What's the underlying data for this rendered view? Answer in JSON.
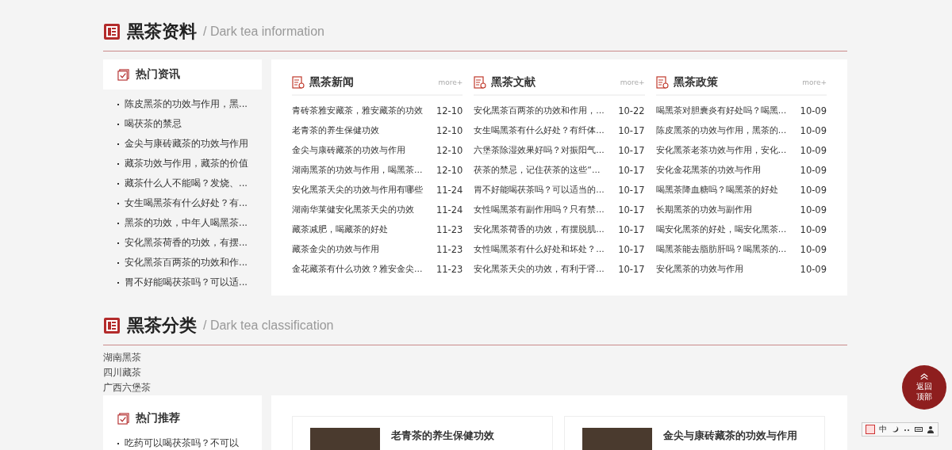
{
  "info_section": {
    "title": "黑茶资料",
    "subtitle": "/ Dark tea information",
    "hot_news": {
      "title": "热门资讯",
      "items": [
        "陈皮黑茶的功效与作用，黑...",
        "喝茯茶的禁忌",
        "金尖与康砖藏茶的功效与作用",
        "藏茶功效与作用，藏茶的价值",
        "藏茶什么人不能喝？发烧、...",
        "女生喝黑茶有什么好处？有...",
        "黑茶的功效，中年人喝黑茶...",
        "安化黑茶荷香的功效，有摆...",
        "安化黑茶百两茶的功效和作...",
        "胃不好能喝茯茶吗？可以适..."
      ]
    },
    "columns": [
      {
        "title": "黑茶新闻",
        "more": "more+",
        "items": [
          {
            "title": "青砖茶雅安藏茶，雅安藏茶的功效",
            "date": "12-10"
          },
          {
            "title": "老青茶的养生保健功效",
            "date": "12-10"
          },
          {
            "title": "金尖与康砖藏茶的功效与作用",
            "date": "12-10"
          },
          {
            "title": "湖南黑茶的功效与作用，喝黑茶...",
            "date": "12-10"
          },
          {
            "title": "安化黑茶天尖的功效与作用有哪些",
            "date": "11-24"
          },
          {
            "title": "湖南华莱健安化黑茶天尖的功效",
            "date": "11-24"
          },
          {
            "title": "藏茶减肥，喝藏茶的好处",
            "date": "11-23"
          },
          {
            "title": "藏茶金尖的功效与作用",
            "date": "11-23"
          },
          {
            "title": "金花藏茶有什么功效？雅安金尖...",
            "date": "11-23"
          }
        ]
      },
      {
        "title": "黑茶文献",
        "more": "more+",
        "items": [
          {
            "title": "安化黑茶百两茶的功效和作用，...",
            "date": "10-22"
          },
          {
            "title": "女生喝黑茶有什么好处？有纤体...",
            "date": "10-17"
          },
          {
            "title": "六堡茶除湿效果好吗？对振阳气...",
            "date": "10-17"
          },
          {
            "title": "茯茶的禁忌，记住茯茶的这些“...",
            "date": "10-17"
          },
          {
            "title": "胃不好能喝茯茶吗？可以适当的...",
            "date": "10-17"
          },
          {
            "title": "女性喝黑茶有副作用吗？只有禁...",
            "date": "10-17"
          },
          {
            "title": "安化黑茶荷香的功效，有摆脱肌...",
            "date": "10-17"
          },
          {
            "title": "女性喝黑茶有什么好处和坏处？...",
            "date": "10-17"
          },
          {
            "title": "安化黑茶天尖的功效，有利于肾...",
            "date": "10-17"
          }
        ]
      },
      {
        "title": "黑茶政策",
        "more": "more+",
        "items": [
          {
            "title": "喝黑茶对胆囊炎有好处吗？喝黑...",
            "date": "10-09"
          },
          {
            "title": "陈皮黑茶的功效与作用，黑茶的...",
            "date": "10-09"
          },
          {
            "title": "安化黑茶老茶功效与作用，安化...",
            "date": "10-09"
          },
          {
            "title": "安化金花黑茶的功效与作用",
            "date": "10-09"
          },
          {
            "title": "喝黑茶降血糖吗？喝黑茶的好处",
            "date": "10-09"
          },
          {
            "title": "长期黑茶的功效与副作用",
            "date": "10-09"
          },
          {
            "title": "喝安化黑茶的好处，喝安化黑茶...",
            "date": "10-09"
          },
          {
            "title": "喝黑茶能去脂肪肝吗？喝黑茶的...",
            "date": "10-09"
          },
          {
            "title": "安化黑茶的功效与作用",
            "date": "10-09"
          }
        ]
      }
    ]
  },
  "category_section": {
    "title": "黑茶分类",
    "subtitle": "/ Dark tea classification",
    "categories": [
      "湖南黑茶",
      "四川藏茶",
      "广西六堡茶"
    ],
    "recommend": {
      "title": "热门推荐",
      "items": [
        "吃药可以喝茯茶吗？不可以"
      ]
    },
    "cards": [
      {
        "title": "老青茶的养生保健功效"
      },
      {
        "title": "金尖与康砖藏茶的功效与作用"
      }
    ]
  },
  "back_to_top": {
    "label": "返回顶部"
  },
  "ime_toolbar": {
    "mode": "中"
  }
}
